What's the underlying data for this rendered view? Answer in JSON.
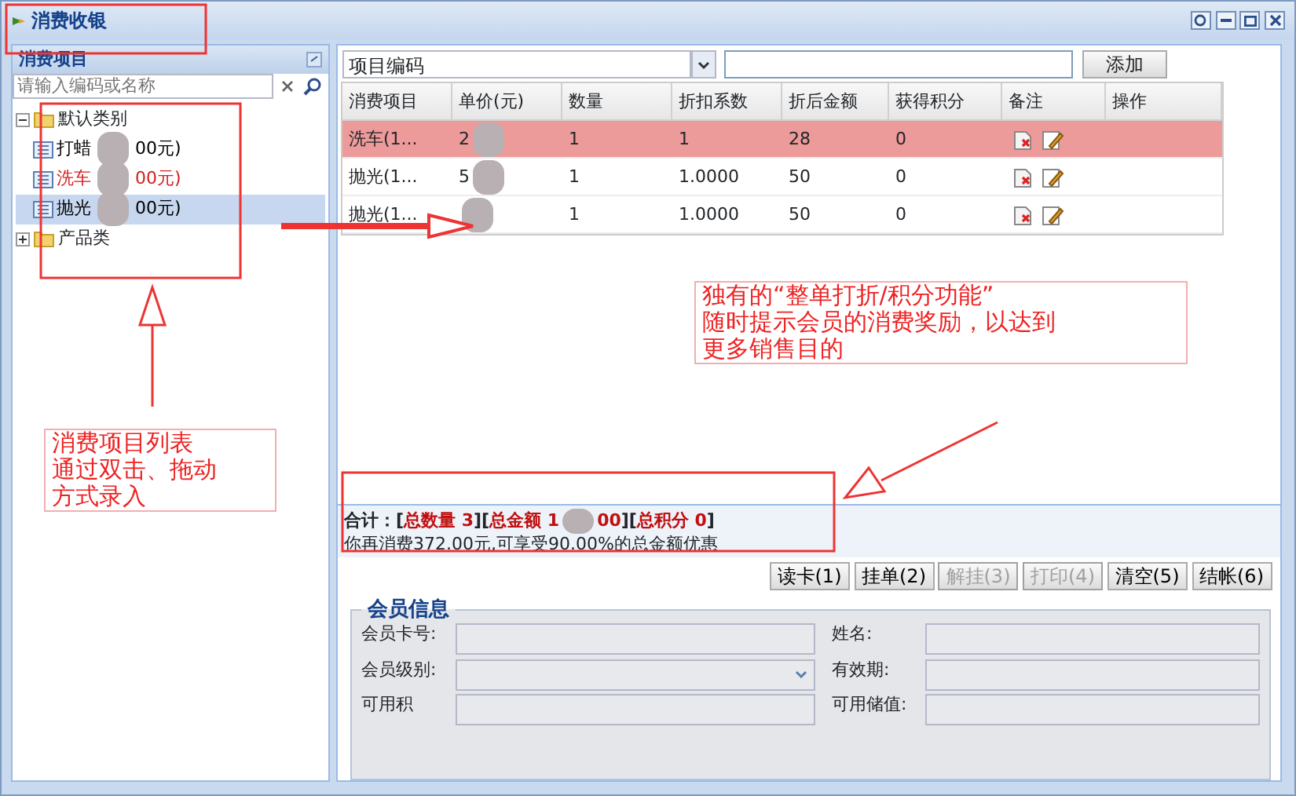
{
  "window": {
    "title": "消费收银"
  },
  "left_panel": {
    "title": "消费项目",
    "search": {
      "placeholder": "请输入编码或名称"
    },
    "tree": [
      {
        "label": "默认类别",
        "expanded": true,
        "children": [
          {
            "label": "打蜡",
            "tail": "00元)",
            "redacted": true,
            "selected": false,
            "color": "#000000"
          },
          {
            "label": "洗车",
            "tail": "00元)",
            "redacted": true,
            "selected": false,
            "color": "#d42020"
          },
          {
            "label": "抛光",
            "tail": "00元)",
            "redacted": true,
            "selected": true,
            "color": "#000000"
          }
        ]
      },
      {
        "label": "产品类",
        "expanded": false
      }
    ]
  },
  "toolbar": {
    "select": "项目编码",
    "button": "添加"
  },
  "grid": {
    "columns": [
      "消费项目",
      "单价(元)",
      "数量",
      "折扣系数",
      "折后金额",
      "获得积分",
      "备注",
      "操作"
    ],
    "rows": [
      {
        "selected": true,
        "cells": [
          "洗车(1...",
          {
            "text": "2",
            "redacted": true
          },
          "1",
          "1",
          "28",
          "0"
        ]
      },
      {
        "selected": false,
        "cells": [
          "抛光(1...",
          {
            "text": "5",
            "redacted": true
          },
          "1",
          "1.0000",
          "50",
          "0"
        ]
      },
      {
        "selected": false,
        "cells": [
          "抛光(1...",
          {
            "redacted": true
          },
          "1",
          "1.0000",
          "50",
          "0"
        ]
      }
    ]
  },
  "totals": {
    "label": "合计：",
    "quantity": "[**总数量 3**]",
    "amount_start": "[**总金额 1**",
    "amount_redacted": true,
    "amount_end": "**00**]",
    "points": "[**总积分 0**]",
    "hint": "你再消费372.00元,可享受90.00%的总金额优惠"
  },
  "actions": [
    {
      "label": "读卡(1)",
      "disabled": false
    },
    {
      "label": "挂单(2)",
      "disabled": false
    },
    {
      "label": "解挂(3)",
      "disabled": true
    },
    {
      "label": "打印(4)",
      "disabled": true
    },
    {
      "label": "清空(5)",
      "disabled": false
    },
    {
      "label": "结帐(6)",
      "disabled": false
    }
  ],
  "member": {
    "title": "会员信息",
    "left": [
      {
        "label": "会员卡号:",
        "kind": "text"
      },
      {
        "label": "会员级别:",
        "kind": "select"
      },
      {
        "label": "可用积",
        "kind": "text"
      }
    ],
    "right": [
      {
        "label": "姓名:",
        "kind": "text"
      },
      {
        "label": "有效期:",
        "kind": "text"
      },
      {
        "label": "可用储值:",
        "kind": "text"
      }
    ]
  },
  "annotations": [
    {
      "lines": [
        "消费项目列表",
        "通过双击、拖动",
        "方式录入"
      ]
    },
    {
      "lines": [
        "独有的“整单打折/积分功能”",
        "随时提示会员的消费奖励，以达到",
        "更多销售目的"
      ]
    }
  ]
}
